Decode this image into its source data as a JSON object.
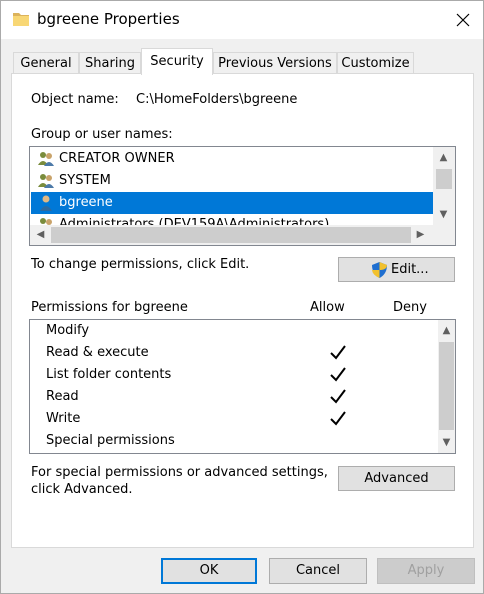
{
  "window": {
    "title": "bgreene Properties"
  },
  "tabs": [
    {
      "label": "General"
    },
    {
      "label": "Sharing"
    },
    {
      "label": "Security"
    },
    {
      "label": "Previous Versions"
    },
    {
      "label": "Customize"
    }
  ],
  "object": {
    "label": "Object name:",
    "value": "C:\\HomeFolders\\bgreene"
  },
  "groups": {
    "label": "Group or user names:",
    "items": [
      {
        "name": "CREATOR OWNER",
        "icon": "group-icon"
      },
      {
        "name": "SYSTEM",
        "icon": "group-icon"
      },
      {
        "name": "bgreene",
        "icon": "user-icon",
        "selected": true
      },
      {
        "name": "Administrators (DEV159A\\Administrators)",
        "icon": "group-icon"
      }
    ]
  },
  "edit": {
    "hint": "To change permissions, click Edit.",
    "button": "Edit..."
  },
  "permissions": {
    "label": "Permissions for bgreene",
    "allow_header": "Allow",
    "deny_header": "Deny",
    "rows": [
      {
        "name": "Modify",
        "allow": false,
        "deny": false
      },
      {
        "name": "Read & execute",
        "allow": true,
        "deny": false
      },
      {
        "name": "List folder contents",
        "allow": true,
        "deny": false
      },
      {
        "name": "Read",
        "allow": true,
        "deny": false
      },
      {
        "name": "Write",
        "allow": true,
        "deny": false
      },
      {
        "name": "Special permissions",
        "allow": false,
        "deny": false
      }
    ]
  },
  "advanced": {
    "hint_line1": "For special permissions or advanced settings,",
    "hint_line2": "click Advanced.",
    "button": "Advanced"
  },
  "footer": {
    "ok": "OK",
    "cancel": "Cancel",
    "apply": "Apply"
  },
  "colors": {
    "selection": "#0078d7",
    "panel": "#ffffff",
    "chrome": "#f0f0f0"
  }
}
